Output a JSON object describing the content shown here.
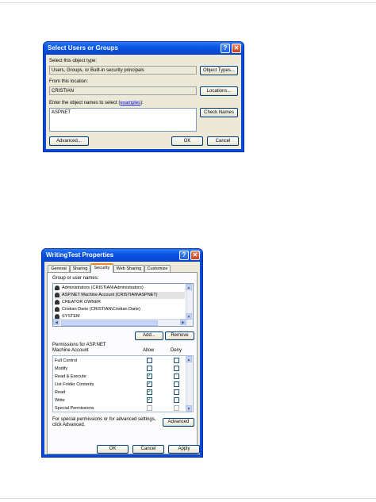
{
  "select_dialog": {
    "title": "Select Users or Groups",
    "object_type_label": "Select this object type:",
    "object_type_value": "Users, Groups, or Built-in security principals",
    "object_types_button": "Object Types...",
    "location_label": "From this location:",
    "location_value": "CRISTIAN",
    "locations_button": "Locations...",
    "names_label_prefix": "Enter the object names to select (",
    "names_label_link": "examples",
    "names_label_suffix": "):",
    "names_value": "ASPNET",
    "check_names_button": "Check Names",
    "advanced_button": "Advanced...",
    "ok_button": "OK",
    "cancel_button": "Cancel"
  },
  "properties_dialog": {
    "title": "WritingTest Properties",
    "tabs": [
      "General",
      "Sharing",
      "Security",
      "Web Sharing",
      "Customize"
    ],
    "active_tab": "Security",
    "group_label": "Group or user names:",
    "users": [
      "Administrators (CRISTIAN\\Administrators)",
      "ASP.NET Machine Account (CRISTIAN\\ASPNET)",
      "CREATOR OWNER",
      "Cristian Darie (CRISTIAN\\Cristian Darie)",
      "SYSTEM"
    ],
    "selected_user": 1,
    "add_button": "Add...",
    "remove_button": "Remove",
    "permissions_label_line1": "Permissions for ASP.NET",
    "permissions_label_line2": "Machine Account",
    "allow_header": "Allow",
    "deny_header": "Deny",
    "permissions": [
      {
        "name": "Full Control",
        "allow": false,
        "deny": false
      },
      {
        "name": "Modify",
        "allow": false,
        "deny": false
      },
      {
        "name": "Read & Execute",
        "allow": true,
        "deny": false
      },
      {
        "name": "List Folder Contents",
        "allow": true,
        "deny": false
      },
      {
        "name": "Read",
        "allow": true,
        "deny": false
      },
      {
        "name": "Write",
        "allow": true,
        "deny": false
      },
      {
        "name": "Special Permissions",
        "allow": false,
        "deny": false
      }
    ],
    "special_text_line1": "For special permissions or for advanced settings,",
    "special_text_line2": "click Advanced.",
    "advanced_button": "Advanced",
    "ok_button": "OK",
    "cancel_button": "Cancel",
    "apply_button": "Apply"
  },
  "icons": {
    "help": "?",
    "close": "✕",
    "check": "✓",
    "scroll_up": "▲",
    "scroll_down": "▼",
    "scroll_left": "◀",
    "scroll_right": "▶"
  }
}
